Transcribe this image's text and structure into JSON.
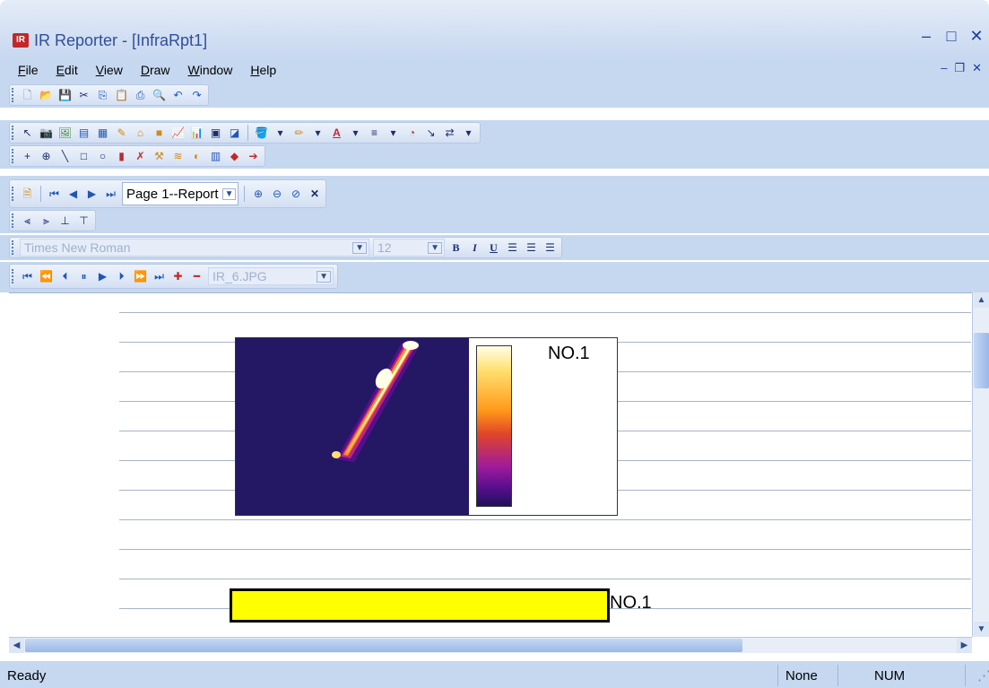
{
  "window": {
    "title": "IR Reporter - [InfraRpt1]",
    "app_icon": "IR",
    "controls": [
      "minimize-icon",
      "maximize-icon",
      "close-icon"
    ]
  },
  "menu": {
    "file": "File",
    "edit": "Edit",
    "view": "View",
    "draw": "Draw",
    "window": "Window",
    "help": "Help"
  },
  "toolbars": {
    "nav": {
      "page_select": "Page 1--Report"
    },
    "font": {
      "family": "Times New Roman",
      "size": "12",
      "bold": "B",
      "italic": "I",
      "underline": "U"
    },
    "playback": {
      "image_select": "IR_6.JPG"
    }
  },
  "document": {
    "thermal_image": {
      "label": "NO.1",
      "palette": [
        "#20105a",
        "#5a0f8f",
        "#a01c9a",
        "#e0452a",
        "#ff9a1a",
        "#ffe070",
        "#ffffe8"
      ]
    },
    "bar": {
      "label": "NO.1",
      "fill": "#ffff00"
    }
  },
  "status": {
    "left": "Ready",
    "mode": "None",
    "num": "NUM"
  }
}
